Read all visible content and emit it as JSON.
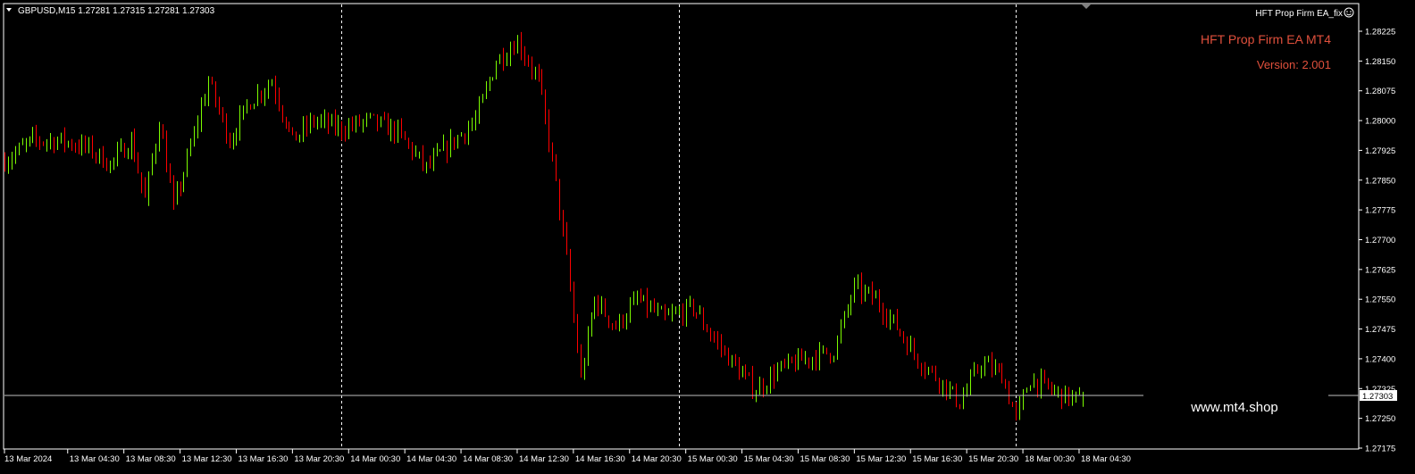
{
  "header": {
    "symbol_menu_icon": "triangle-down-icon",
    "quote_line": "GBPUSD,M15  1.27281 1.27315 1.27281 1.27303"
  },
  "expert": {
    "name_label": "HFT Prop Firm EA_fix",
    "smiley_icon": "smiley-icon",
    "title": "HFT Prop Firm EA MT4",
    "version": "Version: 2.001",
    "text_color": "#e0503c"
  },
  "watermark": "www.mt4.shop",
  "current_price_label": "1.27303",
  "colors": {
    "background": "#000000",
    "bull": "#7CFC00",
    "bear": "#FF0000",
    "grid_separator": "#FFFFFF",
    "price_line": "#C0C0C0",
    "axis": "#FFFFFF"
  },
  "chart_data": {
    "type": "candlestick",
    "symbol": "GBPUSD",
    "timeframe": "M15",
    "title": "",
    "xlabel": "",
    "ylabel": "",
    "ylim": [
      1.2715,
      1.2828
    ],
    "price_ticks": [
      "1.28225",
      "1.28150",
      "1.28075",
      "1.28000",
      "1.27925",
      "1.27850",
      "1.27775",
      "1.27700",
      "1.27625",
      "1.27550",
      "1.27475",
      "1.27400",
      "1.27325",
      "1.27250",
      "1.27175"
    ],
    "time_ticks": [
      "13 Mar 2024",
      "13 Mar 04:30",
      "13 Mar 08:30",
      "13 Mar 12:30",
      "13 Mar 16:30",
      "13 Mar 20:30",
      "14 Mar 00:30",
      "14 Mar 04:30",
      "14 Mar 08:30",
      "14 Mar 12:30",
      "14 Mar 16:30",
      "14 Mar 20:30",
      "15 Mar 00:30",
      "15 Mar 04:30",
      "15 Mar 08:30",
      "15 Mar 12:30",
      "15 Mar 16:30",
      "15 Mar 20:30",
      "18 Mar 00:30",
      "18 Mar 04:30"
    ],
    "day_separators": [
      "14 Mar 2024",
      "15 Mar 2024",
      "18 Mar 2024"
    ],
    "current_price": 1.27303,
    "last_bar": {
      "open": 1.27281,
      "high": 1.27315,
      "low": 1.27281,
      "close": 1.27303
    },
    "close_path": [
      [
        "13 Mar 00:00",
        1.279
      ],
      [
        "13 Mar 02:00",
        1.2795
      ],
      [
        "13 Mar 04:00",
        1.2795
      ],
      [
        "13 Mar 06:00",
        1.2793
      ],
      [
        "13 Mar 07:30",
        1.2789
      ],
      [
        "13 Mar 09:00",
        1.2795
      ],
      [
        "13 Mar 10:00",
        1.278
      ],
      [
        "13 Mar 11:00",
        1.28
      ],
      [
        "13 Mar 12:00",
        1.2778
      ],
      [
        "13 Mar 13:00",
        1.279
      ],
      [
        "13 Mar 14:30",
        1.281
      ],
      [
        "13 Mar 16:00",
        1.2795
      ],
      [
        "13 Mar 17:30",
        1.2805
      ],
      [
        "13 Mar 19:00",
        1.281
      ],
      [
        "13 Mar 20:30",
        1.2795
      ],
      [
        "13 Mar 22:00",
        1.28
      ],
      [
        "14 Mar 00:00",
        1.2798
      ],
      [
        "14 Mar 02:00",
        1.28
      ],
      [
        "14 Mar 04:00",
        1.2797
      ],
      [
        "14 Mar 06:00",
        1.2788
      ],
      [
        "14 Mar 08:00",
        1.2795
      ],
      [
        "14 Mar 09:30",
        1.28
      ],
      [
        "14 Mar 11:00",
        1.2815
      ],
      [
        "14 Mar 12:30",
        1.282
      ],
      [
        "14 Mar 14:00",
        1.281
      ],
      [
        "14 Mar 15:00",
        1.279
      ],
      [
        "14 Mar 16:00",
        1.2765
      ],
      [
        "14 Mar 17:00",
        1.2735
      ],
      [
        "14 Mar 18:00",
        1.2755
      ],
      [
        "14 Mar 19:30",
        1.2748
      ],
      [
        "14 Mar 21:00",
        1.2755
      ],
      [
        "14 Mar 23:00",
        1.275
      ],
      [
        "15 Mar 01:00",
        1.2753
      ],
      [
        "15 Mar 02:30",
        1.2745
      ],
      [
        "15 Mar 04:00",
        1.2738
      ],
      [
        "15 Mar 05:30",
        1.2732
      ],
      [
        "15 Mar 07:00",
        1.2737
      ],
      [
        "15 Mar 09:00",
        1.274
      ],
      [
        "15 Mar 11:00",
        1.2742
      ],
      [
        "15 Mar 12:30",
        1.2758
      ],
      [
        "15 Mar 14:00",
        1.2755
      ],
      [
        "15 Mar 15:30",
        1.2748
      ],
      [
        "15 Mar 17:00",
        1.274
      ],
      [
        "15 Mar 19:00",
        1.2733
      ],
      [
        "15 Mar 20:00",
        1.2729
      ],
      [
        "15 Mar 21:30",
        1.2739
      ],
      [
        "15 Mar 23:00",
        1.2736
      ],
      [
        "18 Mar 00:00",
        1.2725
      ],
      [
        "18 Mar 01:00",
        1.2735
      ],
      [
        "18 Mar 02:30",
        1.2732
      ],
      [
        "18 Mar 04:00",
        1.273
      ],
      [
        "18 Mar 04:45",
        1.27303
      ]
    ]
  }
}
